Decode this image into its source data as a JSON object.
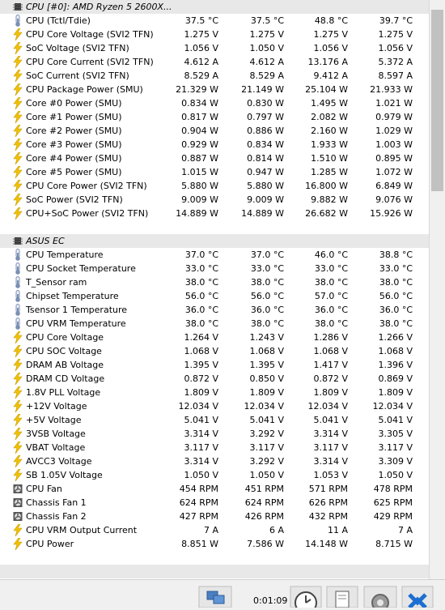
{
  "groups": [
    {
      "name": "CPU [#0]: AMD Ryzen 5 2600X...",
      "icon": "chip-icon",
      "rows": [
        {
          "icon": "thermometer-icon",
          "label": "CPU (Tctl/Tdie)",
          "values": [
            "37.5 °C",
            "37.5 °C",
            "48.8 °C",
            "39.7 °C"
          ]
        },
        {
          "icon": "lightning-icon",
          "label": "CPU Core Voltage (SVI2 TFN)",
          "values": [
            "1.275 V",
            "1.275 V",
            "1.275 V",
            "1.275 V"
          ]
        },
        {
          "icon": "lightning-icon",
          "label": "SoC Voltage (SVI2 TFN)",
          "values": [
            "1.056 V",
            "1.050 V",
            "1.056 V",
            "1.056 V"
          ]
        },
        {
          "icon": "lightning-icon",
          "label": "CPU Core Current (SVI2 TFN)",
          "values": [
            "4.612 A",
            "4.612 A",
            "13.176 A",
            "5.372 A"
          ]
        },
        {
          "icon": "lightning-icon",
          "label": "SoC Current (SVI2 TFN)",
          "values": [
            "8.529 A",
            "8.529 A",
            "9.412 A",
            "8.597 A"
          ]
        },
        {
          "icon": "lightning-icon",
          "label": "CPU Package Power (SMU)",
          "values": [
            "21.329 W",
            "21.149 W",
            "25.104 W",
            "21.933 W"
          ]
        },
        {
          "icon": "lightning-icon",
          "label": "Core #0 Power (SMU)",
          "values": [
            "0.834 W",
            "0.830 W",
            "1.495 W",
            "1.021 W"
          ]
        },
        {
          "icon": "lightning-icon",
          "label": "Core #1 Power (SMU)",
          "values": [
            "0.817 W",
            "0.797 W",
            "2.082 W",
            "0.979 W"
          ]
        },
        {
          "icon": "lightning-icon",
          "label": "Core #2 Power (SMU)",
          "values": [
            "0.904 W",
            "0.886 W",
            "2.160 W",
            "1.029 W"
          ]
        },
        {
          "icon": "lightning-icon",
          "label": "Core #3 Power (SMU)",
          "values": [
            "0.929 W",
            "0.834 W",
            "1.933 W",
            "1.003 W"
          ]
        },
        {
          "icon": "lightning-icon",
          "label": "Core #4 Power (SMU)",
          "values": [
            "0.887 W",
            "0.814 W",
            "1.510 W",
            "0.895 W"
          ]
        },
        {
          "icon": "lightning-icon",
          "label": "Core #5 Power (SMU)",
          "values": [
            "1.015 W",
            "0.947 W",
            "1.285 W",
            "1.072 W"
          ]
        },
        {
          "icon": "lightning-icon",
          "label": "CPU Core Power (SVI2 TFN)",
          "values": [
            "5.880 W",
            "5.880 W",
            "16.800 W",
            "6.849 W"
          ]
        },
        {
          "icon": "lightning-icon",
          "label": "SoC Power (SVI2 TFN)",
          "values": [
            "9.009 W",
            "9.009 W",
            "9.882 W",
            "9.076 W"
          ]
        },
        {
          "icon": "lightning-icon",
          "label": "CPU+SoC Power (SVI2 TFN)",
          "values": [
            "14.889 W",
            "14.889 W",
            "26.682 W",
            "15.926 W"
          ]
        }
      ]
    },
    {
      "name": "ASUS EC",
      "icon": "chip-icon",
      "rows": [
        {
          "icon": "thermometer-icon",
          "label": "CPU Temperature",
          "values": [
            "37.0 °C",
            "37.0 °C",
            "46.0 °C",
            "38.8 °C"
          ]
        },
        {
          "icon": "thermometer-icon",
          "label": "CPU Socket Temperature",
          "values": [
            "33.0 °C",
            "33.0 °C",
            "33.0 °C",
            "33.0 °C"
          ]
        },
        {
          "icon": "thermometer-icon",
          "label": "T_Sensor ram",
          "values": [
            "38.0 °C",
            "38.0 °C",
            "38.0 °C",
            "38.0 °C"
          ]
        },
        {
          "icon": "thermometer-icon",
          "label": "Chipset Temperature",
          "values": [
            "56.0 °C",
            "56.0 °C",
            "57.0 °C",
            "56.0 °C"
          ]
        },
        {
          "icon": "thermometer-icon",
          "label": "Tsensor 1 Temperature",
          "values": [
            "36.0 °C",
            "36.0 °C",
            "36.0 °C",
            "36.0 °C"
          ]
        },
        {
          "icon": "thermometer-icon",
          "label": "CPU VRM Temperature",
          "values": [
            "38.0 °C",
            "38.0 °C",
            "38.0 °C",
            "38.0 °C"
          ]
        },
        {
          "icon": "lightning-icon",
          "label": "CPU Core Voltage",
          "values": [
            "1.264 V",
            "1.243 V",
            "1.286 V",
            "1.266 V"
          ]
        },
        {
          "icon": "lightning-icon",
          "label": "CPU SOC Voltage",
          "values": [
            "1.068 V",
            "1.068 V",
            "1.068 V",
            "1.068 V"
          ]
        },
        {
          "icon": "lightning-icon",
          "label": "DRAM AB Voltage",
          "values": [
            "1.395 V",
            "1.395 V",
            "1.417 V",
            "1.396 V"
          ]
        },
        {
          "icon": "lightning-icon",
          "label": "DRAM CD Voltage",
          "values": [
            "0.872 V",
            "0.850 V",
            "0.872 V",
            "0.869 V"
          ]
        },
        {
          "icon": "lightning-icon",
          "label": "1.8V PLL Voltage",
          "values": [
            "1.809 V",
            "1.809 V",
            "1.809 V",
            "1.809 V"
          ]
        },
        {
          "icon": "lightning-icon",
          "label": "+12V Voltage",
          "values": [
            "12.034 V",
            "12.034 V",
            "12.034 V",
            "12.034 V"
          ]
        },
        {
          "icon": "lightning-icon",
          "label": "+5V Voltage",
          "values": [
            "5.041 V",
            "5.041 V",
            "5.041 V",
            "5.041 V"
          ]
        },
        {
          "icon": "lightning-icon",
          "label": "3VSB Voltage",
          "values": [
            "3.314 V",
            "3.292 V",
            "3.314 V",
            "3.305 V"
          ]
        },
        {
          "icon": "lightning-icon",
          "label": "VBAT Voltage",
          "values": [
            "3.117 V",
            "3.117 V",
            "3.117 V",
            "3.117 V"
          ]
        },
        {
          "icon": "lightning-icon",
          "label": "AVCC3 Voltage",
          "values": [
            "3.314 V",
            "3.292 V",
            "3.314 V",
            "3.309 V"
          ]
        },
        {
          "icon": "lightning-icon",
          "label": "SB 1.05V Voltage",
          "values": [
            "1.050 V",
            "1.050 V",
            "1.053 V",
            "1.050 V"
          ]
        },
        {
          "icon": "fan-icon",
          "label": "CPU Fan",
          "values": [
            "454 RPM",
            "451 RPM",
            "571 RPM",
            "478 RPM"
          ]
        },
        {
          "icon": "fan-icon",
          "label": "Chassis Fan 1",
          "values": [
            "624 RPM",
            "624 RPM",
            "626 RPM",
            "625 RPM"
          ]
        },
        {
          "icon": "fan-icon",
          "label": "Chassis Fan 2",
          "values": [
            "427 RPM",
            "426 RPM",
            "432 RPM",
            "429 RPM"
          ]
        },
        {
          "icon": "lightning-icon",
          "label": "CPU VRM Output Current",
          "values": [
            "7 A",
            "6 A",
            "11 A",
            "7 A"
          ]
        },
        {
          "icon": "lightning-icon",
          "label": "CPU Power",
          "values": [
            "8.851 W",
            "7.586 W",
            "14.148 W",
            "8.715 W"
          ]
        }
      ]
    }
  ],
  "status_bar": {
    "timer": "0:01:09",
    "buttons": [
      "network-icon",
      "clock-icon",
      "report-icon",
      "settings-icon",
      "close-icon"
    ]
  },
  "colors": {
    "group_bg": "#e8e8e8",
    "lightning": "#f2c200",
    "thermometer": "#7a8fb3",
    "close": "#1c6fd1"
  }
}
